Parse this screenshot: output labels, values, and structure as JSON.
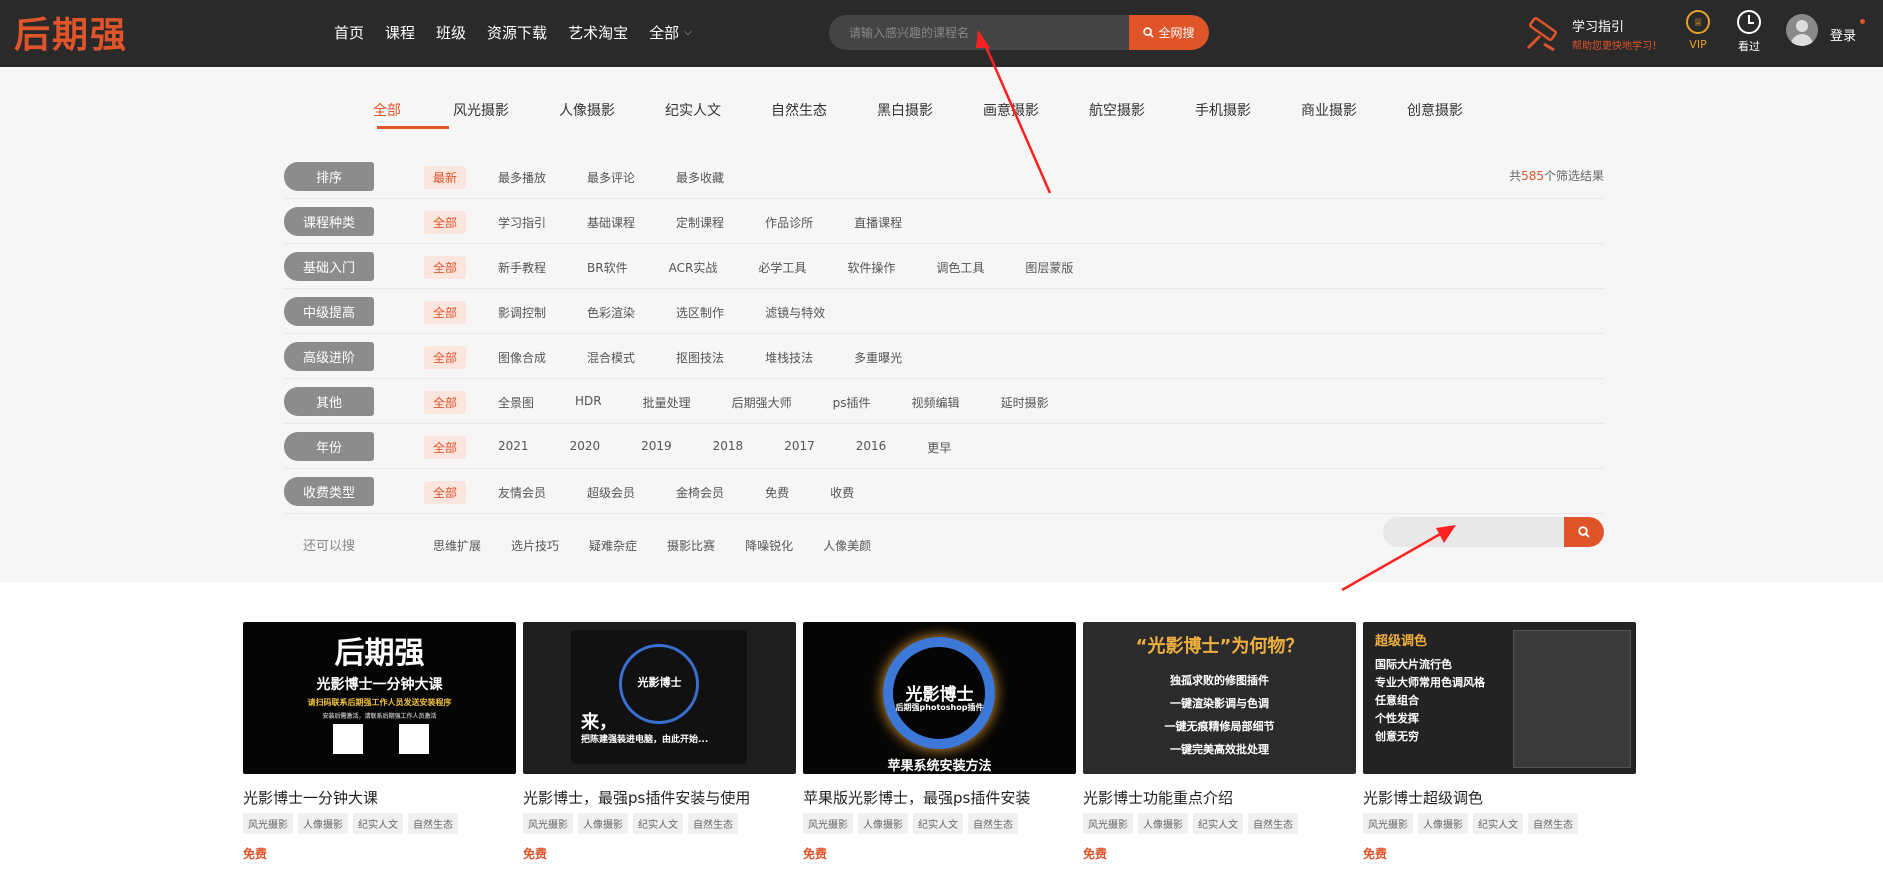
{
  "header": {
    "logo_text": "后期强",
    "nav": [
      "首页",
      "课程",
      "班级",
      "资源下载",
      "艺术淘宝",
      "全部"
    ],
    "search_placeholder": "请输入感兴趣的课程名",
    "search_button": "全网搜",
    "guide_title": "学习指引",
    "guide_subtitle": "帮助您更快地学习！",
    "vip_label": "VIP",
    "history_label": "看过",
    "login_label": "登录"
  },
  "categories": {
    "items": [
      "全部",
      "风光摄影",
      "人像摄影",
      "纪实人文",
      "自然生态",
      "黑白摄影",
      "画意摄影",
      "航空摄影",
      "手机摄影",
      "商业摄影",
      "创意摄影"
    ],
    "active_index": 0
  },
  "filters": [
    {
      "label": "排序",
      "options": [
        "最新",
        "最多播放",
        "最多评论",
        "最多收藏"
      ],
      "selected": 0
    },
    {
      "label": "课程种类",
      "options": [
        "全部",
        "学习指引",
        "基础课程",
        "定制课程",
        "作品诊所",
        "直播课程"
      ],
      "selected": 0
    },
    {
      "label": "基础入门",
      "options": [
        "全部",
        "新手教程",
        "BR软件",
        "ACR实战",
        "必学工具",
        "软件操作",
        "调色工具",
        "图层蒙版"
      ],
      "selected": 0
    },
    {
      "label": "中级提高",
      "options": [
        "全部",
        "影调控制",
        "色彩渲染",
        "选区制作",
        "滤镜与特效"
      ],
      "selected": 0
    },
    {
      "label": "高级进阶",
      "options": [
        "全部",
        "图像合成",
        "混合模式",
        "抠图技法",
        "堆栈技法",
        "多重曝光"
      ],
      "selected": 0
    },
    {
      "label": "其他",
      "options": [
        "全部",
        "全景图",
        "HDR",
        "批量处理",
        "后期强大师",
        "ps插件",
        "视频编辑",
        "延时摄影"
      ],
      "selected": 0
    },
    {
      "label": "年份",
      "options": [
        "全部",
        "2021",
        "2020",
        "2019",
        "2018",
        "2017",
        "2016",
        "更早"
      ],
      "selected": 0
    },
    {
      "label": "收费类型",
      "options": [
        "全部",
        "友情会员",
        "超级会员",
        "金椅会员",
        "免费",
        "收费"
      ],
      "selected": 0
    }
  ],
  "results": {
    "prefix": "共",
    "count": "585",
    "suffix": "个筛选结果"
  },
  "also_search": {
    "label": "还可以搜",
    "options": [
      "思维扩展",
      "选片技巧",
      "疑难杂症",
      "摄影比赛",
      "降噪锐化",
      "人像美颜"
    ]
  },
  "cards": [
    {
      "title": "光影博士一分钟大课",
      "tags": [
        "风光摄影",
        "人像摄影",
        "纪实人文",
        "自然生态"
      ],
      "price": "免费",
      "thumb_lines": [
        "后期强",
        "光影博士一分钟大课",
        "请扫码联系后期强工作人员发送安装程序",
        "安装后需激活，请联系后期强工作人员激活"
      ]
    },
    {
      "title": "光影博士，最强ps插件安装与使用",
      "tags": [
        "风光摄影",
        "人像摄影",
        "纪实人文",
        "自然生态"
      ],
      "price": "免费",
      "thumb_lines": [
        "光影博士",
        "来，",
        "把陈建强装进电脑，由此开始..."
      ]
    },
    {
      "title": "苹果版光影博士，最强ps插件安装",
      "tags": [
        "风光摄影",
        "人像摄影",
        "纪实人文",
        "自然生态"
      ],
      "price": "免费",
      "thumb_lines": [
        "光影博士",
        "后期强photoshop插件",
        "苹果系统安装方法"
      ]
    },
    {
      "title": "光影博士功能重点介绍",
      "tags": [
        "风光摄影",
        "人像摄影",
        "纪实人文",
        "自然生态"
      ],
      "price": "免费",
      "thumb_lines": [
        "“光影博士”为何物？",
        "独孤求败的修图插件",
        "一键渲染影调与色调",
        "一键无痕精修局部细节",
        "一键完美高效批处理"
      ]
    },
    {
      "title": "光影博士超级调色",
      "tags": [
        "风光摄影",
        "人像摄影",
        "纪实人文",
        "自然生态"
      ],
      "price": "免费",
      "thumb_lines": [
        "超级调色",
        "国际大片流行色",
        "专业大师常用色调风格",
        "任意组合",
        "个性发挥",
        "创意无穷"
      ]
    }
  ],
  "colors": {
    "accent": "#e0542a",
    "header_bg": "#2a2a2a",
    "filter_bg": "#f6f6f6",
    "label_bg": "#8c8c8c",
    "annotation_arrow": "#ff2020"
  },
  "icons": [
    "logo-camera-icon",
    "chevron-down-icon",
    "search-icon",
    "guide-icon",
    "vip-crown-icon",
    "clock-icon",
    "user-avatar-icon"
  ]
}
